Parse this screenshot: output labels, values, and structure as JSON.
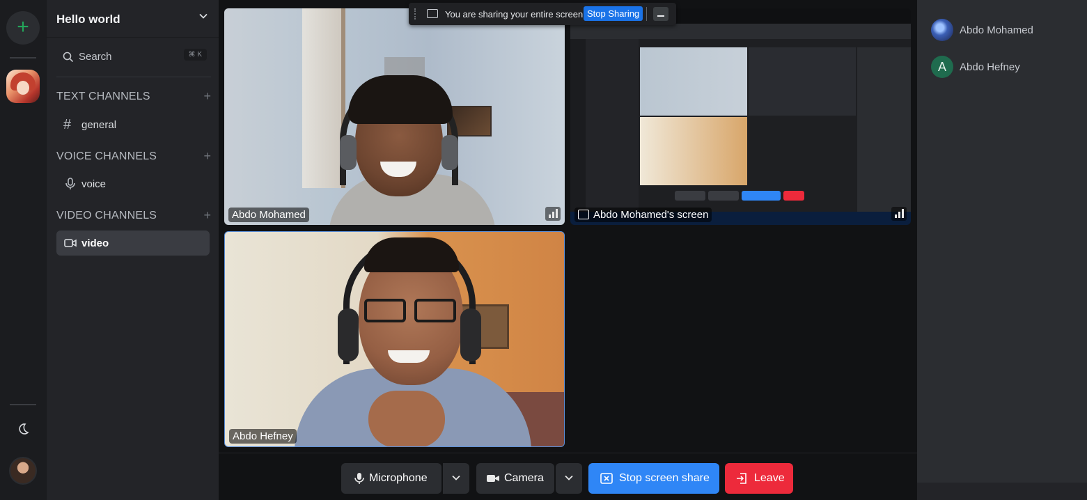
{
  "rail": {
    "add_glyph": "+",
    "icons": [
      "plus-icon",
      "server-avatar",
      "moon-icon",
      "user-avatar"
    ]
  },
  "server": {
    "name": "Hello world"
  },
  "search": {
    "label": "Search",
    "shortcut": "⌘ K"
  },
  "categories": {
    "text": "TEXT CHANNELS",
    "voice": "VOICE CHANNELS",
    "video": "VIDEO CHANNELS"
  },
  "channels": {
    "text": [
      {
        "name": "general",
        "icon": "hash-icon",
        "glyph": "#"
      }
    ],
    "voice": [
      {
        "name": "voice",
        "icon": "microphone-icon"
      }
    ],
    "video": [
      {
        "name": "video",
        "icon": "video-camera-icon",
        "active": true
      }
    ]
  },
  "tiles": {
    "cam1": {
      "label": "Abdo Mohamed"
    },
    "screen": {
      "label": "Abdo Mohamed's screen"
    },
    "cam2": {
      "label": "Abdo Hefney"
    }
  },
  "share_banner": {
    "message": "You are sharing your entire screen.",
    "stop_label": "Stop Sharing"
  },
  "controls": {
    "microphone": "Microphone",
    "camera": "Camera",
    "stop_screen_share": "Stop screen share",
    "leave": "Leave"
  },
  "members": [
    {
      "name": "Abdo Mohamed",
      "avatar": "image"
    },
    {
      "name": "Abdo Hefney",
      "avatar": "initial",
      "initial": "A"
    }
  ],
  "colors": {
    "accent_blue": "#2f86f6",
    "danger_red": "#ed2a3b",
    "online_green": "#23a55a",
    "banner_blue": "#1a73e8"
  }
}
